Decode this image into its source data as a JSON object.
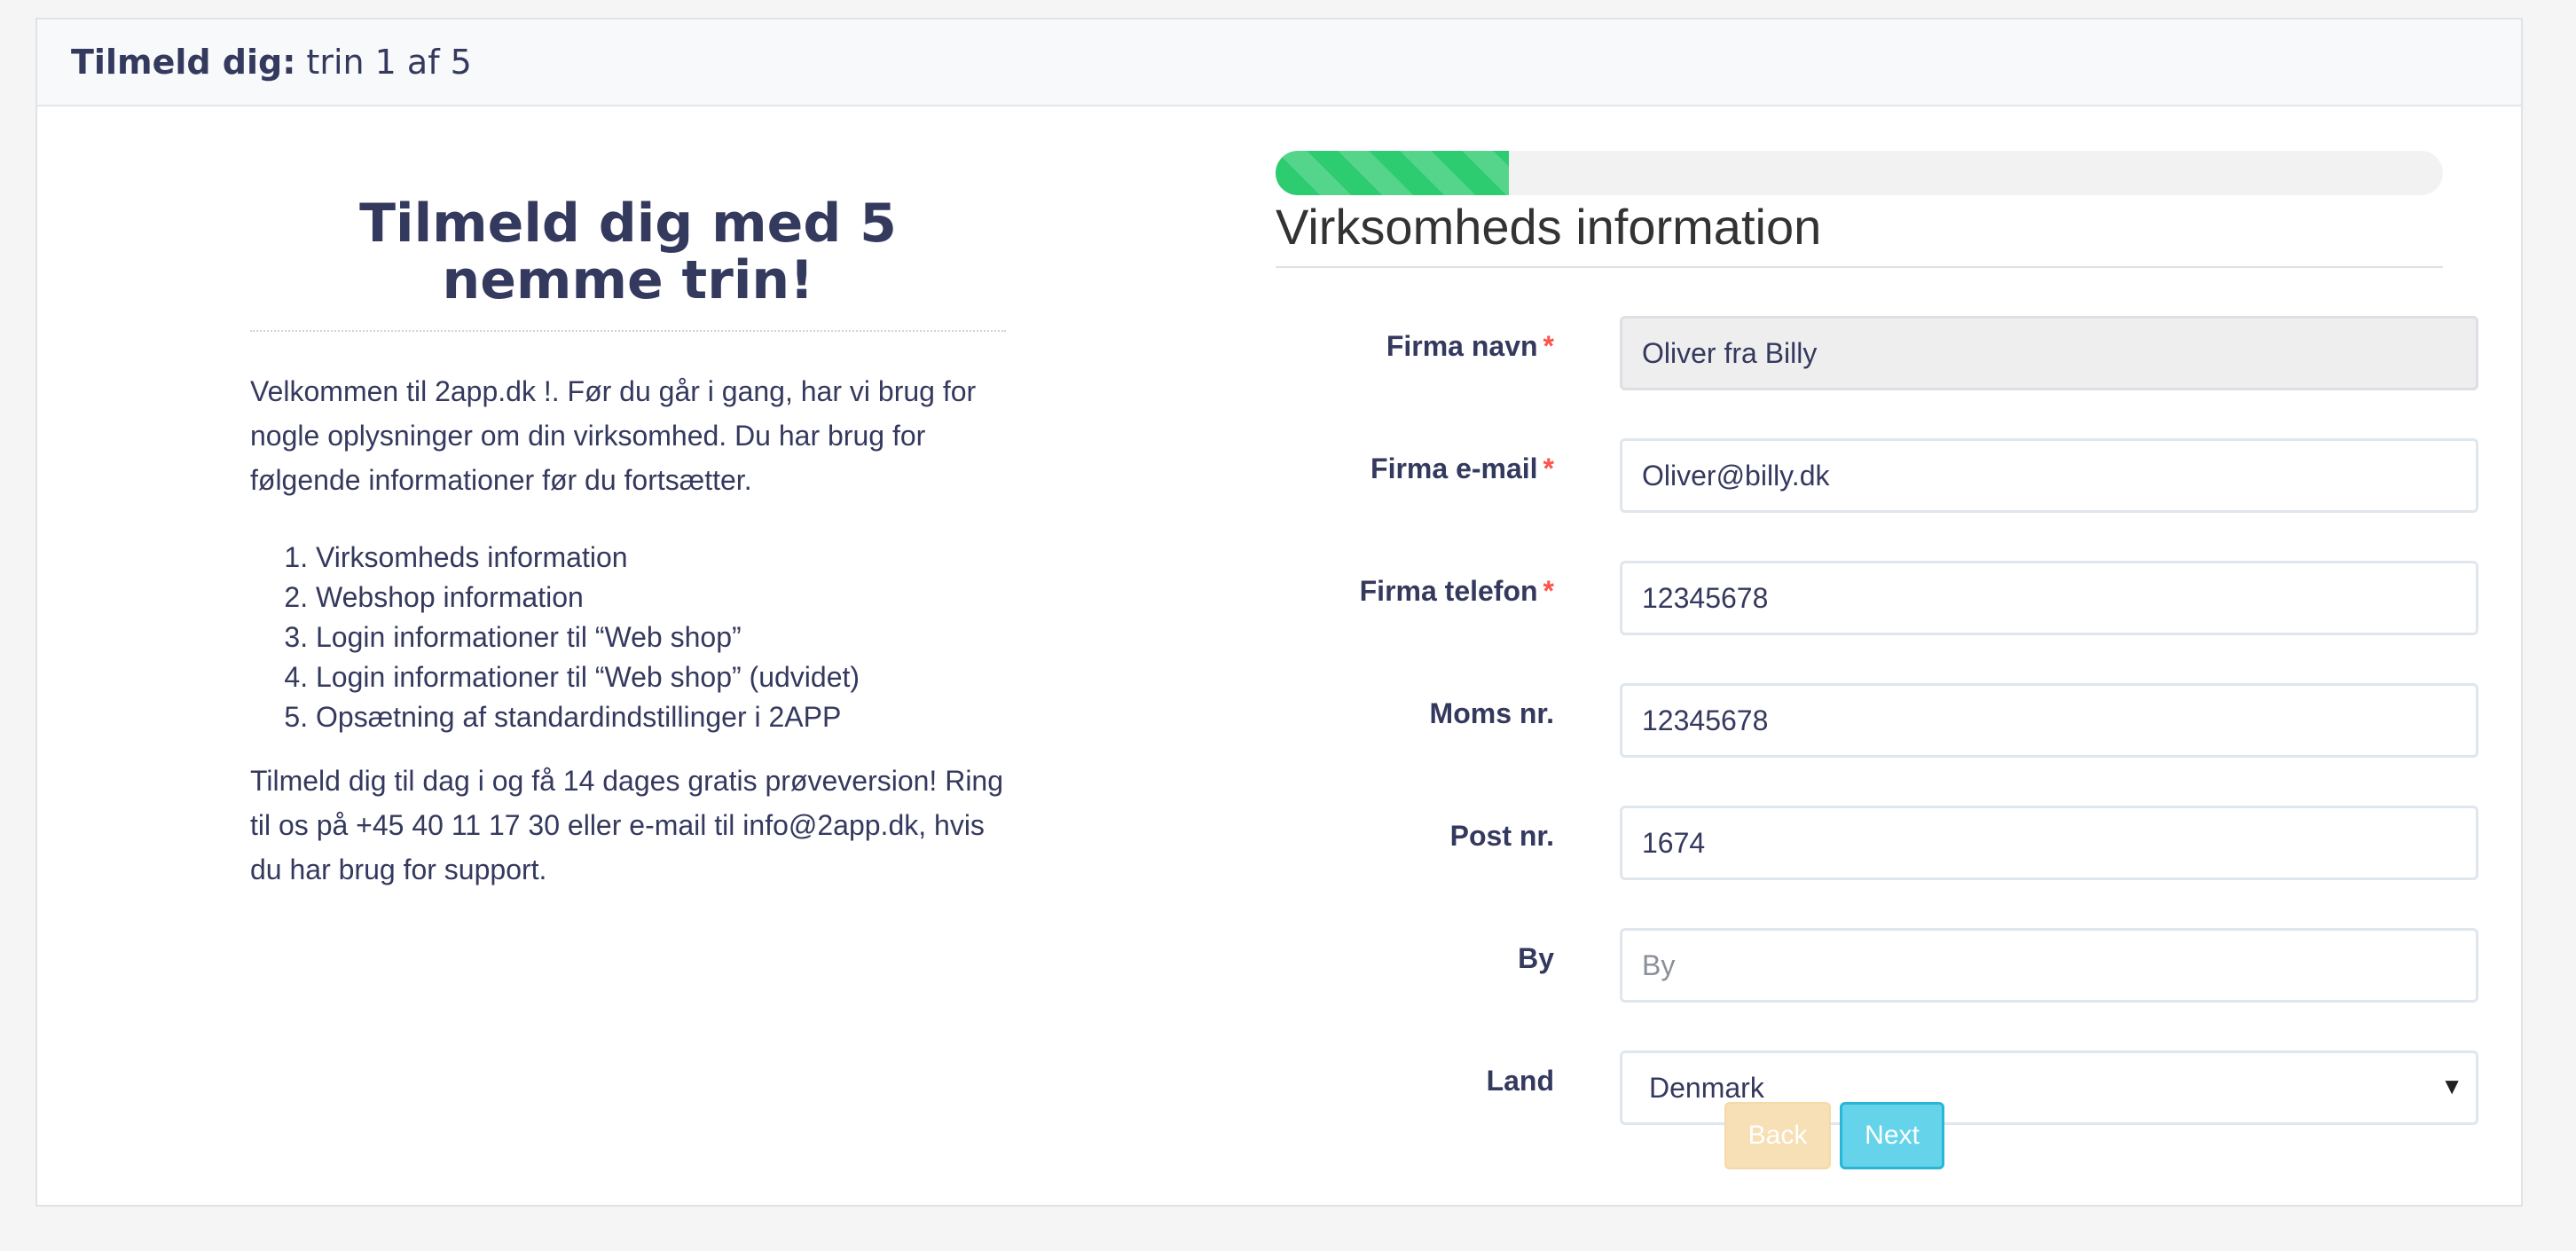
{
  "header": {
    "title_strong": "Tilmeld dig:",
    "title_step": "trin 1 af 5"
  },
  "intro": {
    "title": "Tilmeld dig med 5 nemme trin!",
    "paragraph1": "Velkommen til 2app.dk !. Før du går i gang, har vi brug for nogle oplysninger om din virksomhed. Du har brug for følgende informationer før du fortsætter.",
    "steps": [
      "Virksomheds information",
      "Webshop information",
      "Login informationer til “Web shop”",
      "Login informationer til “Web shop” (udvidet)",
      "Opsætning af standardindstillinger i 2APP"
    ],
    "paragraph2": "Tilmeld dig til dag i og få 14 dages gratis prøveversion! Ring til os på +45 40 11 17 30 eller e-mail til info@2app.dk, hvis du har brug for support."
  },
  "progress": {
    "value": 0.2,
    "color": "#2ecc71"
  },
  "form": {
    "section_title": "Virksomheds information",
    "required_mark": "*",
    "fields": {
      "firma_navn": {
        "label": "Firma navn",
        "value": "Oliver fra Billy",
        "required": true,
        "readonly": true
      },
      "firma_email": {
        "label": "Firma e-mail",
        "value": "Oliver@billy.dk",
        "required": true
      },
      "firma_telefon": {
        "label": "Firma telefon",
        "value": "12345678",
        "required": true
      },
      "moms_nr": {
        "label": "Moms nr.",
        "value": "12345678"
      },
      "post_nr": {
        "label": "Post nr.",
        "value": "1674"
      },
      "by": {
        "label": "By",
        "value": "",
        "placeholder": "By"
      },
      "land": {
        "label": "Land",
        "value": "Denmark"
      }
    },
    "back_label": "Back",
    "next_label": "Next"
  },
  "colors": {
    "text": "#34395e",
    "required": "#fc544b",
    "back_button": "#f7dfb6",
    "next_button": "#65d4ea"
  }
}
